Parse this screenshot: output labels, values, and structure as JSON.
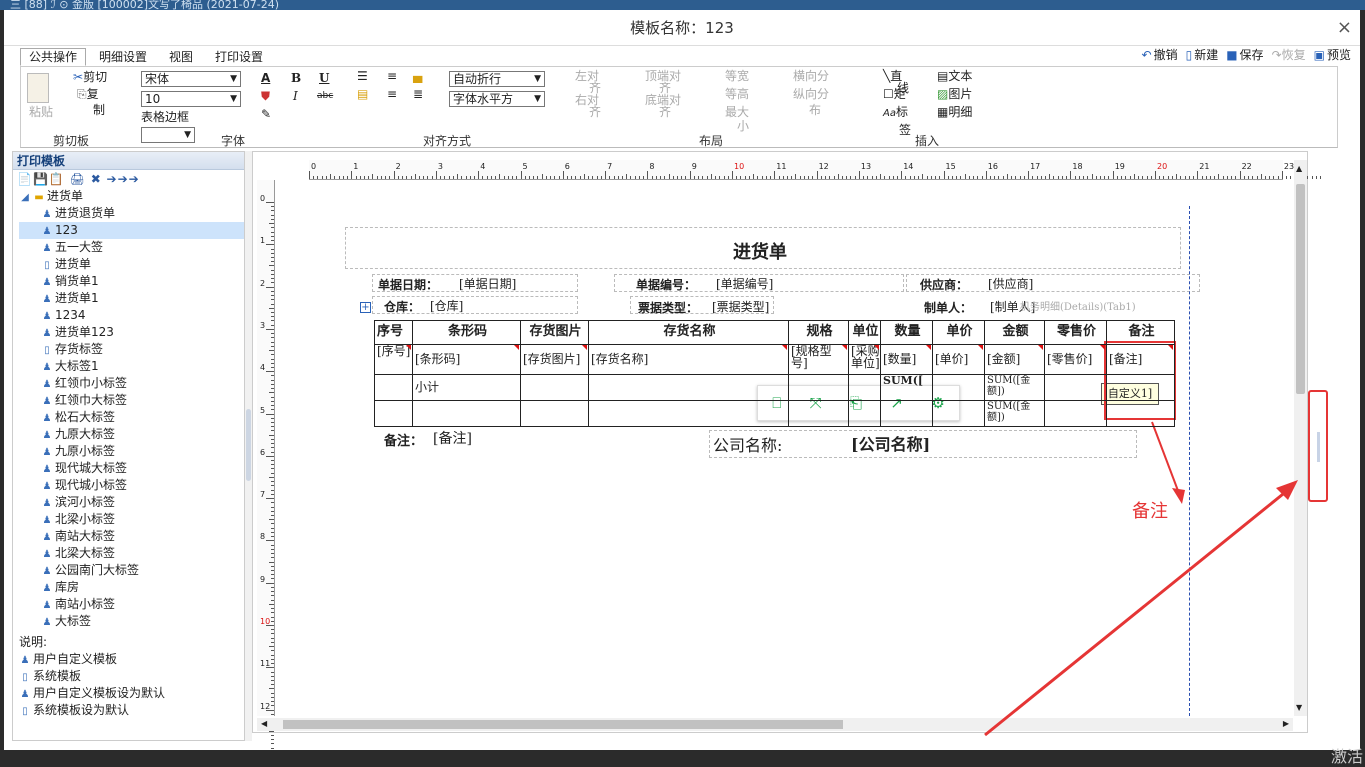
{
  "topstrip_text": "三 [88]  ℐ  ⊙ 金版    [100002]文写了椅品    (2021-07-24)",
  "dialog": {
    "title": "模板名称：123",
    "close": "×"
  },
  "tabs": [
    "公共操作",
    "明细设置",
    "视图",
    "打印设置"
  ],
  "quick_actions": {
    "undo": "撤销",
    "new": "新建",
    "save": "保存",
    "redo": "恢复",
    "preview": "预览"
  },
  "ribbon": {
    "clipboard": {
      "paste": "粘贴",
      "cut": "剪切",
      "copy1": "复",
      "copy2": "制",
      "label": "剪切板"
    },
    "font": {
      "family": "宋体",
      "size": "10",
      "border": "表格边框",
      "label": "字体",
      "a_color": "A",
      "bold": "B",
      "underline": "U",
      "italic": "I",
      "strike": "abc"
    },
    "align": {
      "wrap": "自动折行",
      "halign": "字体水平方",
      "label": "对齐方式"
    },
    "layout": {
      "left_align": "左对",
      "left_align2": "齐",
      "top_align": "顶端对",
      "top_align2": "齐",
      "equal_width": "等宽",
      "h_dist": "横向分",
      "right_align": "右对",
      "right_align2": "齐",
      "bottom_align": "底端对",
      "bottom_align2": "齐",
      "equal_height": "等高",
      "v_dist": "纵向分",
      "v_dist2": "布",
      "max_width": "最大",
      "max_width2": "小",
      "label": "布局"
    },
    "insert": {
      "line": "直",
      "line2": "线",
      "rect": "矩",
      "rect2": "形",
      "label_ctl": "标",
      "label_ctl2": "签",
      "text": "文本",
      "image": "图片",
      "detail": "明细",
      "label": "插入"
    }
  },
  "left_panel": {
    "title": "打印模板",
    "toolbar": "📄💾📋 🖨 ✖ ➔➔➔",
    "root": "进货单",
    "items": [
      "进货退货单",
      "123",
      "五一大签",
      "进货单",
      "销货单1",
      "进货单1",
      "1234",
      "进货单123",
      "存货标签",
      "大标签1",
      "红领巾小标签",
      "红领巾大标签",
      "松石大标签",
      "九原大标签",
      "九原小标签",
      "现代城大标签",
      "现代城小标签",
      "滨河小标签",
      "北梁小标签",
      "南站大标签",
      "北梁大标签",
      "公园南门大标签",
      "库房",
      "南站小标签",
      "大标签"
    ],
    "legend_title": "说明:",
    "legend": [
      "用户自定义模板",
      "系统模板",
      "用户自定义模板设为默认",
      "系统模板设为默认"
    ]
  },
  "ruler": {
    "h": [
      "0",
      "1",
      "2",
      "3",
      "4",
      "5",
      "6",
      "7",
      "8",
      "9",
      "10",
      "11",
      "12",
      "13",
      "14",
      "15",
      "16",
      "17",
      "18",
      "19",
      "20",
      "21",
      "22",
      "23"
    ],
    "v": [
      "0",
      "1",
      "2",
      "3",
      "4",
      "5",
      "6",
      "7",
      "8",
      "9",
      "10",
      "11",
      "12"
    ]
  },
  "form": {
    "title": "进货单",
    "date_label": "单据日期：",
    "date_value": "[单据日期]",
    "no_label": "单据编号：",
    "no_value": "[单据编号]",
    "supplier_label": "供应商：",
    "supplier_value": "[供应商]",
    "warehouse_label": "仓库：",
    "warehouse_value": "[仓库]",
    "type_label": "票据类型：",
    "type_value": "[票据类型]",
    "maker_label": "制单人：",
    "maker_value": "[制单人]",
    "detail_ghost": "机务明细(Details)(Tab1)",
    "headers": [
      "序号",
      "条形码",
      "存货图片",
      "存货名称",
      "规格",
      "单位",
      "数量",
      "单价",
      "金额",
      "零售价",
      "备注"
    ],
    "row1": [
      "[序号]",
      "[条形码]",
      "[存货图片]",
      "[存货名称]",
      "[规格型号]",
      "[采购单位]",
      "[数量]",
      "[单价]",
      "[金额]",
      "[零售价]",
      "[备注]"
    ],
    "subtotal": "小计",
    "sum_qty": "SUM([",
    "sum_amt": "SUM([金额])",
    "remark_label": "备注：",
    "remark_value": "[备注]",
    "company_label": "公司名称:",
    "company_value": "[公司名称]"
  },
  "float_toolbar": [
    "⎕",
    "⤧",
    "⎗",
    "↗",
    "⚙"
  ],
  "tooltip": "自定义1]",
  "annotation": "备注",
  "bottom_text": "激活"
}
